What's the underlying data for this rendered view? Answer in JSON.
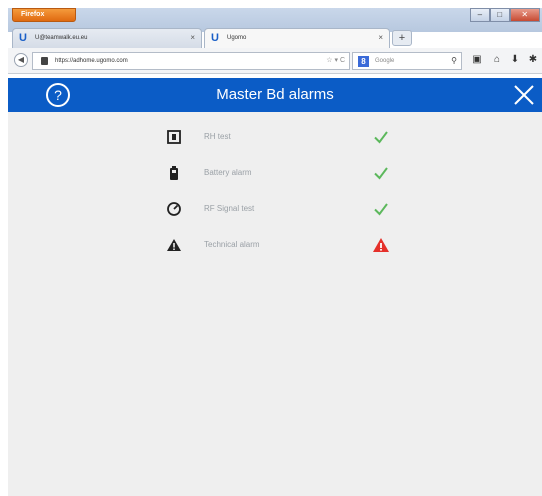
{
  "browser": {
    "app_menu_label": "Firefox",
    "window_controls": [
      "–",
      "□",
      "✕"
    ],
    "tabs": [
      {
        "label": "U@teamwalk.eu.eu",
        "close": "×"
      },
      {
        "label": "Ugomo",
        "close": "×"
      }
    ],
    "new_tab_label": "+",
    "url": "https://adhome.ugomo.com",
    "url_controls": "☆ ▾ C",
    "search_placeholder": "Google",
    "search_engine_letter": "8"
  },
  "header": {
    "title": "Master Bd alarms",
    "help_icon": "?",
    "accent_color": "#0b5cc6"
  },
  "alarms": [
    {
      "icon": "rf-unit-icon",
      "label": "RH test",
      "status": "ok"
    },
    {
      "icon": "battery-icon",
      "label": "Battery alarm",
      "status": "ok"
    },
    {
      "icon": "signal-gauge-icon",
      "label": "RF Signal test",
      "status": "ok"
    },
    {
      "icon": "warning-icon",
      "label": "Technical alarm",
      "status": "alarm"
    }
  ],
  "colors": {
    "ok": "#5cb85c",
    "alarm": "#e5302a"
  }
}
